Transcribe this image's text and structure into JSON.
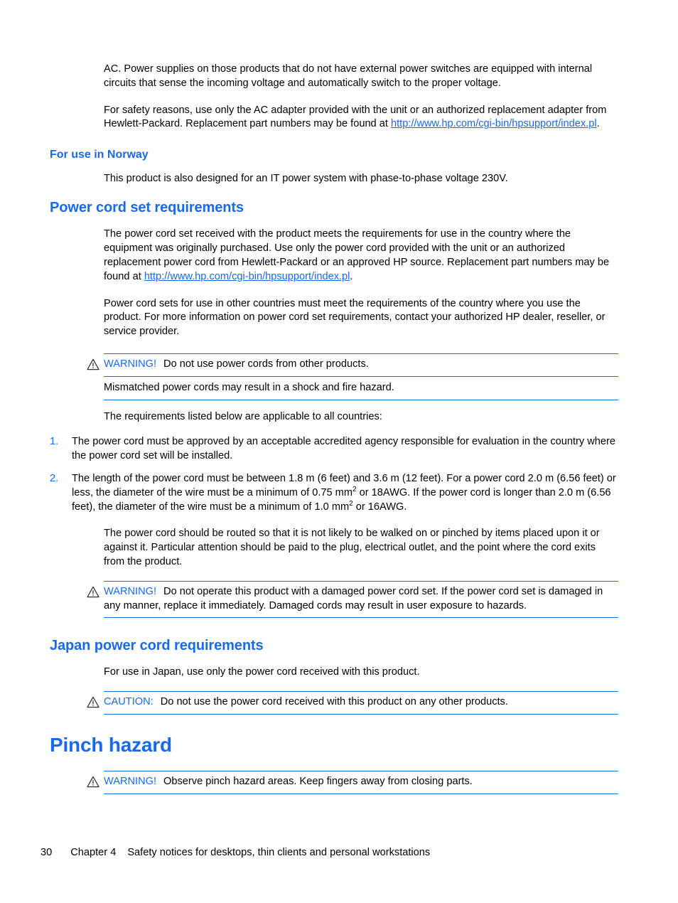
{
  "document": {
    "intro": {
      "para1": "AC. Power supplies on those products that do not have external power switches are equipped with internal circuits that sense the incoming voltage and automatically switch to the proper voltage.",
      "para2_before_link": "For safety reasons, use only the AC adapter provided with the unit or an authorized replacement adapter from Hewlett-Packard. Replacement part numbers may be found at ",
      "para2_link": "http://www.hp.com/cgi-bin/hpsupport/index.pl",
      "para2_after_link": "."
    },
    "norway": {
      "heading": "For use in Norway",
      "para": "This product is also designed for an IT power system with phase-to-phase voltage 230V."
    },
    "power_cord_set": {
      "heading": "Power cord set requirements",
      "para1_before_link": "The power cord set received with the product meets the requirements for use in the country where the equipment was originally purchased. Use only the power cord provided with the unit or an authorized replacement power cord from Hewlett-Packard or an approved HP source. Replacement part numbers may be found at ",
      "para1_link": "http://www.hp.com/cgi-bin/hpsupport/index.pl",
      "para1_after_link": ".",
      "para2": "Power cord sets for use in other countries must meet the requirements of the country where you use the product. For more information on power cord set requirements, contact your authorized HP dealer, reseller, or service provider.",
      "warning1": {
        "icon": "warning-triangle-icon",
        "label": "WARNING!",
        "text": "Do not use power cords from other products.",
        "text2": "Mismatched power cords may result in a shock and fire hazard."
      },
      "requirements_intro": "The requirements listed below are applicable to all countries:",
      "requirements": [
        {
          "number": "1.",
          "text": "The power cord must be approved by an acceptable accredited agency responsible for evaluation in the country where the power cord set will be installed."
        },
        {
          "number": "2.",
          "text_part1": "The length of the power cord must be between 1.8 m (6 feet) and 3.6 m (12 feet). For a power cord 2.0 m (6.56 feet) or less, the diameter of the wire must be a minimum of 0.75 mm",
          "sup1": "2",
          "text_part2": " or 18AWG. If the power cord is longer than 2.0 m (6.56 feet), the diameter of the wire must be a minimum of 1.0 mm",
          "sup2": "2",
          "text_part3": " or 16AWG."
        }
      ],
      "routing_para": "The power cord should be routed so that it is not likely to be walked on or pinched by items placed upon it or against it. Particular attention should be paid to the plug, electrical outlet, and the point where the cord exits from the product.",
      "warning2": {
        "icon": "warning-triangle-icon",
        "label": "WARNING!",
        "text": "Do not operate this product with a damaged power cord set. If the power cord set is damaged in any manner, replace it immediately. Damaged cords may result in user exposure to hazards."
      }
    },
    "japan": {
      "heading": "Japan power cord requirements",
      "para": "For use in Japan, use only the power cord received with this product.",
      "caution": {
        "icon": "caution-triangle-icon",
        "label": "CAUTION:",
        "text": "Do not use the power cord received with this product on any other products."
      }
    },
    "pinch_hazard": {
      "heading": "Pinch hazard",
      "warning": {
        "icon": "warning-triangle-icon",
        "label": "WARNING!",
        "text": "Observe pinch hazard areas. Keep fingers away from closing parts."
      }
    },
    "footer": {
      "page_number": "30",
      "chapter": "Chapter 4",
      "chapter_title": "Safety notices for desktops, thin clients and personal workstations"
    },
    "colors": {
      "heading_blue": "#1a6ae8",
      "link_blue": "#1a6ae8",
      "rule_blue": "#1a6ae8",
      "body_text": "#000000",
      "background": "#ffffff"
    }
  }
}
